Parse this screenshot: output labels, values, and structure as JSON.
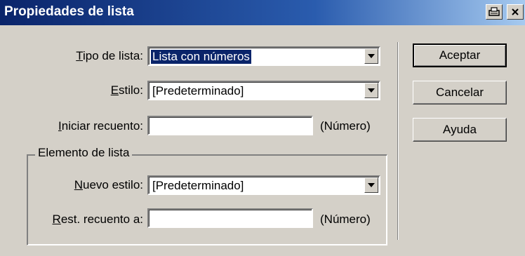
{
  "window": {
    "title": "Propiedades de lista",
    "buttons": [
      {
        "name": "print-icon"
      },
      {
        "name": "close-icon"
      }
    ]
  },
  "form": {
    "tipo": {
      "label_mnemonic": "T",
      "label_rest": "ipo de lista:",
      "value": "Lista con números"
    },
    "estilo": {
      "label_mnemonic": "E",
      "label_rest": "stilo:",
      "value": "[Predeterminado]"
    },
    "iniciar": {
      "label_mnemonic": "I",
      "label_rest": "niciar recuento:",
      "value": "",
      "unit": "(Número)"
    }
  },
  "elemento": {
    "group_title": "Elemento de lista",
    "nuevo_estilo": {
      "label_mnemonic": "N",
      "label_rest": "uevo estilo:",
      "value": "[Predeterminado]"
    },
    "rest_recuento": {
      "label_mnemonic": "R",
      "label_rest": "est. recuento a:",
      "value": "",
      "unit": "(Número)"
    }
  },
  "actions": {
    "aceptar": "Aceptar",
    "cancelar": "Cancelar",
    "ayuda": "Ayuda"
  },
  "colors": {
    "titlebar": "#0a246a",
    "face": "#d4d0c8",
    "selection": "#0a246a"
  }
}
